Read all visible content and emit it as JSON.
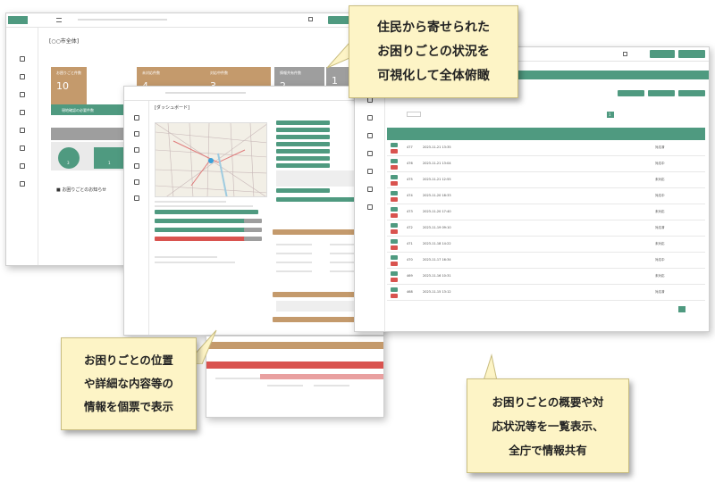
{
  "callouts": {
    "top": [
      "住民から寄せられた",
      "お困りごとの状況を",
      "可視化して全体俯瞰"
    ],
    "bottom_left": [
      "お困りごとの位置",
      "や詳細な内容等の",
      "情報を個票で表示"
    ],
    "bottom_right": [
      "お困りごとの概要や対",
      "応状況等を一覧表示、",
      "全庁で情報共有"
    ]
  },
  "dashboard": {
    "title": "[○○市全体]",
    "stats": [
      {
        "label": "お困りごと件数",
        "value": "10"
      },
      {
        "label": "未対応件数",
        "value": "4"
      },
      {
        "label": "対応中件数",
        "value": "3"
      },
      {
        "label": "情報共有件数",
        "value": "2"
      },
      {
        "label": "",
        "value": "1"
      }
    ],
    "section_label": "現地確認の必要件数",
    "notice": "お困りごとのお知らせ",
    "contact_counts": [
      "3",
      "1"
    ]
  },
  "detail": {
    "title": "[ダッシュボード]"
  },
  "list": {
    "rows": [
      {
        "no": "477",
        "date": "2023-11-21 13:35",
        "status": "対応済"
      },
      {
        "no": "476",
        "date": "2023-11-21 13:04",
        "status": "対応中"
      },
      {
        "no": "475",
        "date": "2023-11-21 12:55",
        "status": "未対応"
      },
      {
        "no": "474",
        "date": "2023-11-20 18:33",
        "status": "対応中"
      },
      {
        "no": "473",
        "date": "2023-11-20 17:40",
        "status": "未対応"
      },
      {
        "no": "472",
        "date": "2023-11-19 09:10",
        "status": "対応済"
      },
      {
        "no": "471",
        "date": "2023-11-18 14:22",
        "status": "未対応"
      },
      {
        "no": "470",
        "date": "2023-11-17 16:34",
        "status": "対応中"
      },
      {
        "no": "469",
        "date": "2023-11-16 10:31",
        "status": "未対応"
      },
      {
        "no": "468",
        "date": "2023-11-15 13:12",
        "status": "対応済"
      }
    ],
    "page": "1"
  },
  "colors": {
    "accent": "#4f9a80",
    "tan": "#c49a6c",
    "red": "#d9534f",
    "callout_bg": "#fdf4c6"
  }
}
